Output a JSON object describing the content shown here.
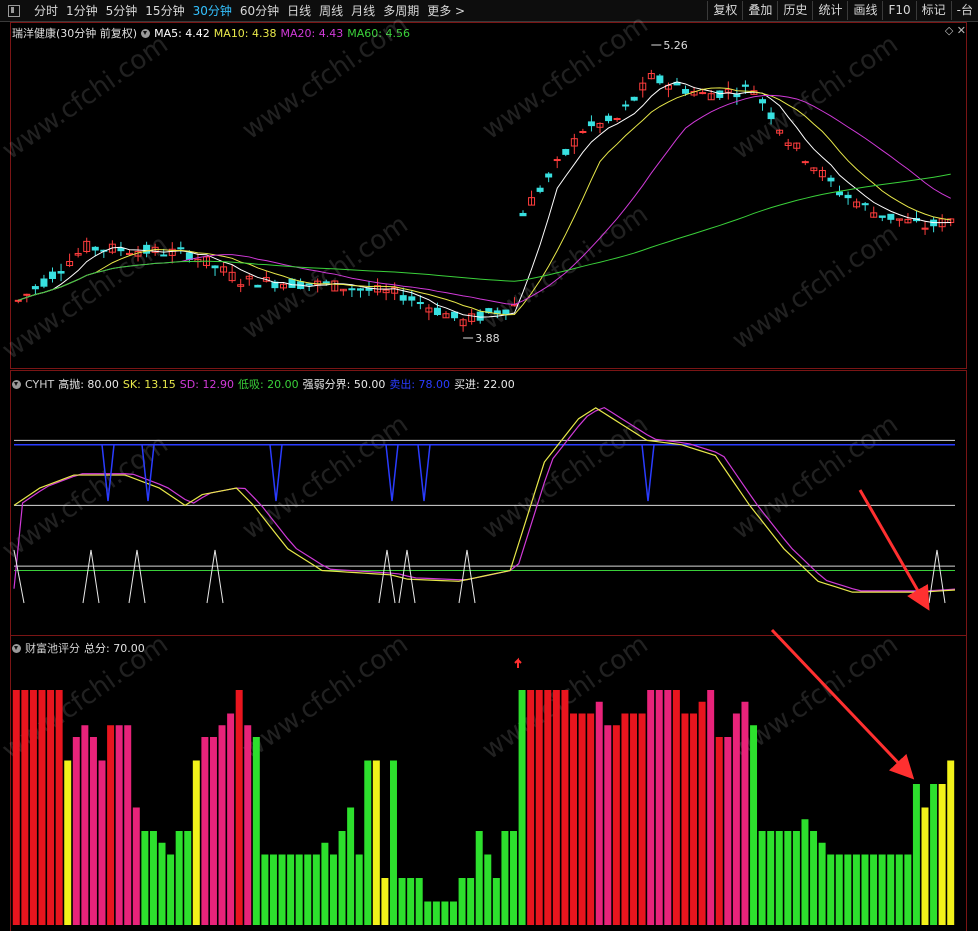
{
  "toolbar": {
    "periods": [
      "分时",
      "1分钟",
      "5分钟",
      "15分钟",
      "30分钟",
      "60分钟",
      "日线",
      "周线",
      "月线",
      "多周期",
      "更多 >"
    ],
    "active_index": 4,
    "right_buttons": [
      "复权",
      "叠加",
      "历史",
      "统计",
      "画线",
      "F10",
      "标记",
      "-台"
    ]
  },
  "main_panel": {
    "title": "瑞洋健康(30分钟 前复权)",
    "ma5": "MA5: 4.42",
    "ma10": "MA10: 4.38",
    "ma20": "MA20: 4.43",
    "ma60": "MA60: 4.56",
    "high_label": "5.26",
    "low_label": "3.88",
    "controls": "◇ ✕"
  },
  "cyht_panel": {
    "name": "CYHT",
    "gaopao": "高抛: 80.00",
    "sk": "SK: 13.15",
    "sd": "SD: 12.90",
    "dixi": "低吸: 20.00",
    "qrfj": "强弱分界: 50.00",
    "maichu": "卖出: 78.00",
    "maijin": "买进: 22.00"
  },
  "score_panel": {
    "name": "财富池评分",
    "total": "总分: 70.00"
  },
  "watermark": "www.cfchi.com",
  "colors": {
    "up": "#ff3d3d",
    "down": "#38e0e0",
    "ma5": "#ffffff",
    "ma10": "#e8e84a",
    "ma20": "#d03ad8",
    "ma60": "#3ad03a",
    "bar_red": "#e8151e",
    "bar_pink": "#e8237a",
    "bar_yellow": "#f2f21a",
    "bar_green": "#2de02d",
    "arrow": "#ff3030"
  },
  "chart_data": {
    "type": "bar",
    "title": "财富池评分",
    "ylim": [
      0,
      100
    ],
    "categories": [],
    "series": [
      {
        "values": [
          100,
          100,
          100,
          100,
          100,
          100,
          70,
          80,
          85,
          80,
          70,
          85,
          85,
          85,
          50,
          40,
          40,
          35,
          30,
          40,
          40,
          70,
          80,
          80,
          85,
          90,
          100,
          85,
          80,
          30,
          30,
          30,
          30,
          30,
          30,
          30,
          35,
          30,
          40,
          50,
          30,
          70,
          70,
          20,
          70,
          20,
          20,
          20,
          10,
          10,
          10,
          10,
          20,
          20,
          40,
          30,
          20,
          40,
          40,
          100,
          100,
          100,
          100,
          100,
          100,
          90,
          90,
          90,
          95,
          85,
          85,
          90,
          90,
          90,
          100,
          100,
          100,
          100,
          90,
          90,
          95,
          100,
          80,
          80,
          90,
          95,
          85,
          40,
          40,
          40,
          40,
          40,
          45,
          40,
          35,
          30,
          30,
          30,
          30,
          30,
          30,
          30,
          30,
          30,
          30,
          60,
          50,
          60,
          60,
          70
        ],
        "colors": "rrrrrrypppprpppggggggypppprpggggggggggggggyyggggggggggggggggrrrrrrrrpprrrrppprrrrprpppggggggggggggggggggggygyyy"
      }
    ]
  }
}
